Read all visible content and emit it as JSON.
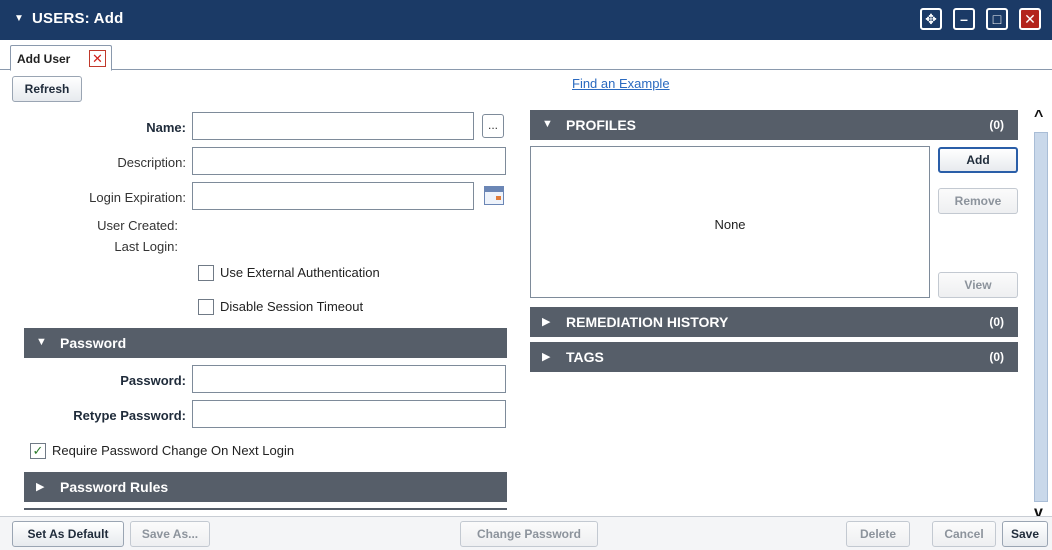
{
  "window": {
    "title": "USERS: Add",
    "controls": {
      "move": "✥",
      "minimize": "–",
      "maximize": "□",
      "close": "✕"
    }
  },
  "tabs": [
    {
      "label": "Add User",
      "close": "✕"
    }
  ],
  "toolbar": {
    "refresh_label": "Refresh",
    "find_example_link": "Find an Example"
  },
  "form": {
    "name_label": "Name:",
    "name_value": "",
    "browse_label": "...",
    "description_label": "Description:",
    "description_value": "",
    "login_expiration_label": "Login Expiration:",
    "login_expiration_value": "",
    "user_created_label": "User Created:",
    "last_login_label": "Last Login:",
    "use_external_auth_label": "Use External Authentication",
    "use_external_auth_checked": false,
    "disable_session_timeout_label": "Disable Session Timeout",
    "disable_session_timeout_checked": false
  },
  "password_section": {
    "title": "Password",
    "password_label": "Password:",
    "retype_label": "Retype Password:",
    "require_change_label": "Require Password Change On Next Login",
    "require_change_checked": true,
    "check_mark": "✓"
  },
  "password_rules_section": {
    "title": "Password Rules"
  },
  "profiles_section": {
    "title": "PROFILES",
    "count": "(0)",
    "empty_text": "None",
    "add_label": "Add",
    "remove_label": "Remove",
    "view_label": "View"
  },
  "remediation_section": {
    "title": "REMEDIATION HISTORY",
    "count": "(0)"
  },
  "tags_section": {
    "title": "TAGS",
    "count": "(0)"
  },
  "arrows": {
    "expanded": "▼",
    "collapsed": "▶",
    "scroll_up": "^",
    "scroll_down": "v"
  },
  "footer": {
    "set_as_default": "Set As Default",
    "save_as": "Save As...",
    "change_password": "Change Password",
    "delete": "Delete",
    "cancel": "Cancel",
    "save": "Save"
  },
  "colors": {
    "titlebar": "#1b3a66",
    "section_header": "#565e69",
    "close_red": "#b3241d",
    "link_blue": "#2a6ac0",
    "scroll_thumb": "#c9d8ea"
  }
}
